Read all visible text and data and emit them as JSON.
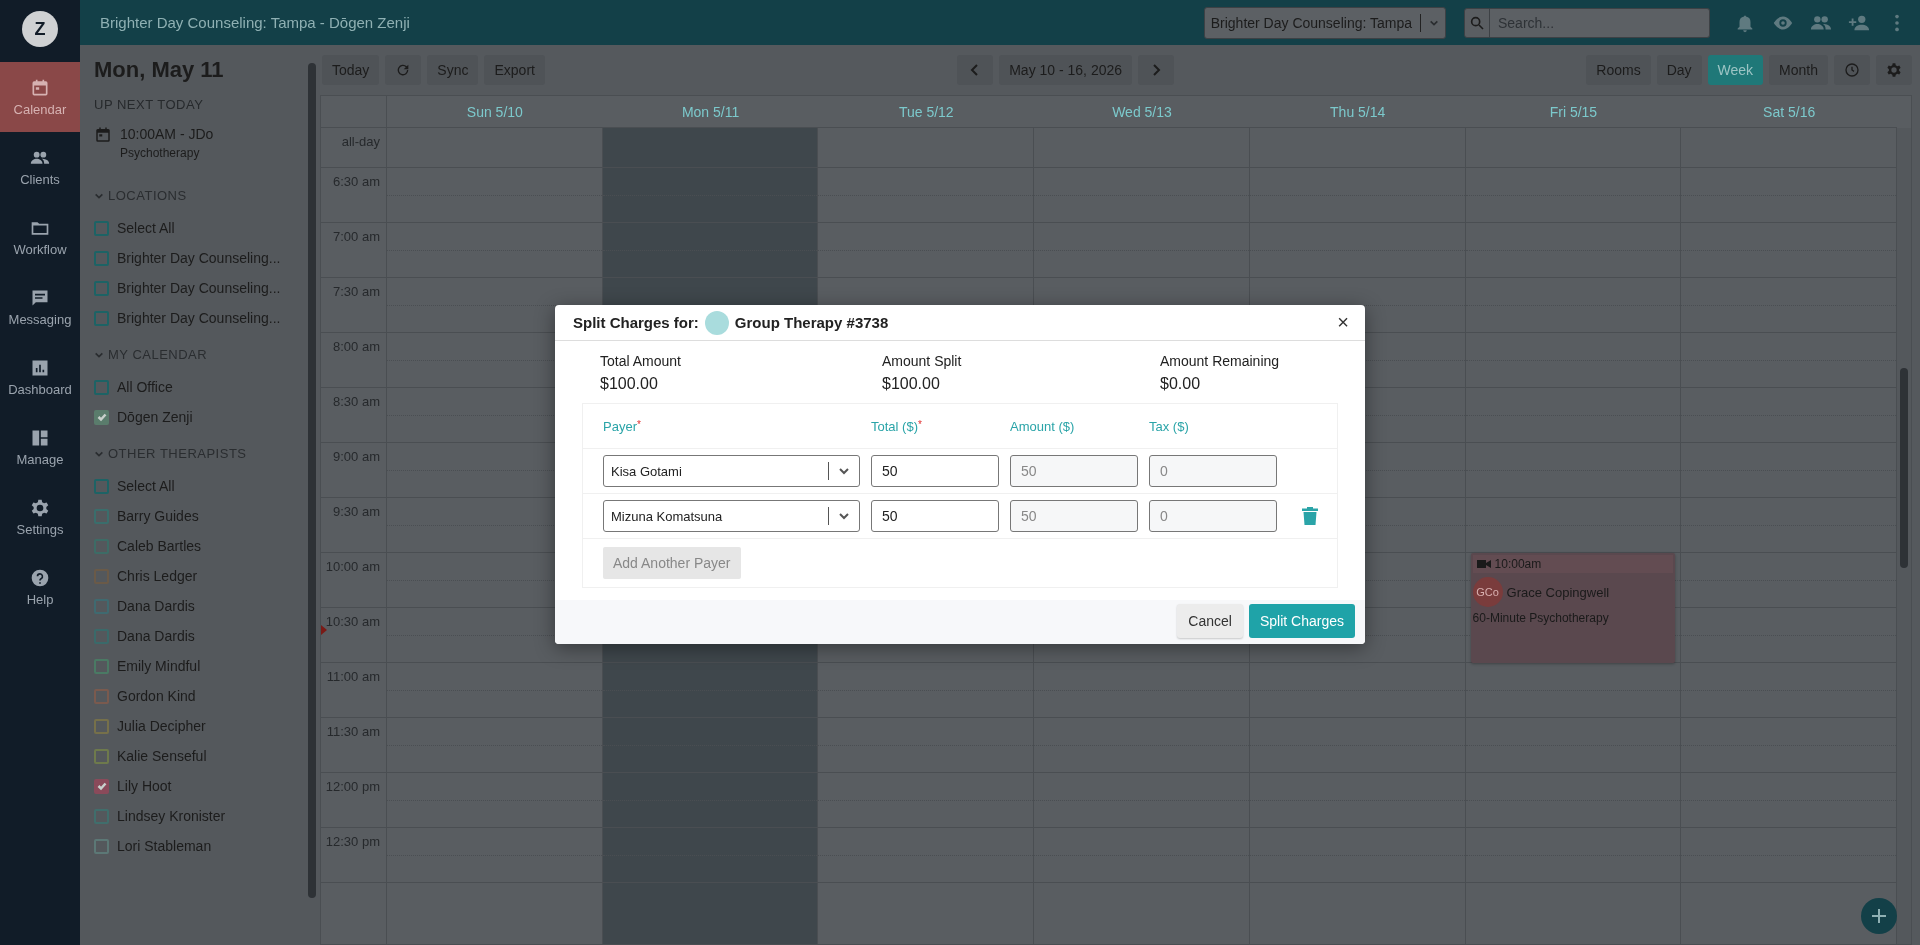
{
  "app": {
    "logo_letter": "Z"
  },
  "top_bar": {
    "title": "Brighter Day Counseling: Tampa - Dōgen Zenji",
    "location_select": "Brighter Day Counseling: Tampa",
    "search": {
      "placeholder": "Search..."
    }
  },
  "nav": [
    {
      "kind": "calendar",
      "label": "Calendar",
      "selected": true
    },
    {
      "kind": "clients",
      "label": "Clients",
      "selected": false
    },
    {
      "kind": "workflow",
      "label": "Workflow",
      "selected": false
    },
    {
      "kind": "messaging",
      "label": "Messaging",
      "selected": false
    },
    {
      "kind": "dashboard",
      "label": "Dashboard",
      "selected": false
    },
    {
      "kind": "manage",
      "label": "Manage",
      "selected": false
    },
    {
      "kind": "settings",
      "label": "Settings",
      "selected": false
    },
    {
      "kind": "help",
      "label": "Help",
      "selected": false
    }
  ],
  "sidebar": {
    "date": "Mon, May 11",
    "up_next_heading": "UP NEXT TODAY",
    "up_next": {
      "time": "10:00AM - JDo",
      "service": "Psychotherapy"
    },
    "sections": [
      {
        "title": "LOCATIONS",
        "expanded": true,
        "items": [
          {
            "label": "Select All",
            "checked": false,
            "color": "#1d6365"
          },
          {
            "label": "Brighter Day Counseling...",
            "checked": false,
            "color": "#1d6365"
          },
          {
            "label": "Brighter Day Counseling...",
            "checked": false,
            "color": "#1d6365"
          },
          {
            "label": "Brighter Day Counseling...",
            "checked": false,
            "color": "#1d6365"
          }
        ]
      },
      {
        "title": "MY CALENDAR",
        "expanded": true,
        "items": [
          {
            "label": "All Office",
            "checked": false,
            "color": "#1d6365"
          },
          {
            "label": "Dōgen Zenji",
            "checked": true,
            "color": "#5a7c6c"
          }
        ]
      },
      {
        "title": "OTHER THERAPISTS",
        "expanded": true,
        "items": [
          {
            "label": "Select All",
            "checked": false,
            "color": "#1d6365"
          },
          {
            "label": "Barry Guides",
            "checked": false,
            "color": "#3a6e6c"
          },
          {
            "label": "Caleb Bartles",
            "checked": false,
            "color": "#3d6c66"
          },
          {
            "label": "Chris Ledger",
            "checked": false,
            "color": "#6a5a48"
          },
          {
            "label": "Dana Dardis",
            "checked": false,
            "color": "#3f6a70"
          },
          {
            "label": "Dana Dardis",
            "checked": false,
            "color": "#3a6a6a"
          },
          {
            "label": "Emily Mindful",
            "checked": false,
            "color": "#4a7a64"
          },
          {
            "label": "Gordon Kind",
            "checked": false,
            "color": "#7a5a4e"
          },
          {
            "label": "Julia Decipher",
            "checked": false,
            "color": "#76704a"
          },
          {
            "label": "Kalie Senseful",
            "checked": false,
            "color": "#6e7a4c"
          },
          {
            "label": "Lily Hoot",
            "checked": true,
            "color": "#8a4a5a"
          },
          {
            "label": "Lindsey Kronister",
            "checked": false,
            "color": "#406e6c"
          },
          {
            "label": "Lori Stableman",
            "checked": false,
            "color": "#5c7876"
          }
        ]
      }
    ]
  },
  "toolbar": {
    "left": [
      {
        "kind": "text",
        "label": "Today"
      },
      {
        "kind": "refresh"
      },
      {
        "kind": "text",
        "label": "Sync"
      },
      {
        "kind": "text",
        "label": "Export"
      }
    ],
    "range": "May 10 - 16, 2026",
    "views": [
      {
        "label": "Rooms",
        "selected": false
      },
      {
        "label": "Day",
        "selected": false
      },
      {
        "label": "Week",
        "selected": true
      },
      {
        "label": "Month",
        "selected": false
      }
    ]
  },
  "calendar": {
    "all_day_label": "all-day",
    "times": [
      "6:30 am",
      "7:00 am",
      "7:30 am",
      "8:00 am",
      "8:30 am",
      "9:00 am",
      "9:30 am",
      "10:00 am",
      "10:30 am",
      "11:00 am",
      "11:30 am",
      "12:00 pm",
      "12:30 pm"
    ],
    "days": [
      {
        "label": "Sun 5/10",
        "today": false
      },
      {
        "label": "Mon 5/11",
        "today": true
      },
      {
        "label": "Tue 5/12",
        "today": false
      },
      {
        "label": "Wed 5/13",
        "today": false
      },
      {
        "label": "Thu 5/14",
        "today": false
      },
      {
        "label": "Fri 5/15",
        "today": false,
        "events": [
          {
            "time": "10:00am",
            "video": true,
            "initials": "GCo",
            "client": "Grace Copingwell",
            "service": "60-Minute Psychotherapy"
          }
        ]
      },
      {
        "label": "Sat 5/16",
        "today": false
      }
    ]
  },
  "modal": {
    "title": "Split Charges for:",
    "subject": "Group Therapy #3738",
    "close_label": "×",
    "summary": [
      {
        "label": "Total Amount",
        "value": "$100.00"
      },
      {
        "label": "Amount Split",
        "value": "$100.00"
      },
      {
        "label": "Amount Remaining",
        "value": "$0.00"
      }
    ],
    "columns": [
      {
        "label": "Payer",
        "required_mark": "*"
      },
      {
        "label": "Total ($)",
        "required_mark": "*"
      },
      {
        "label": "Amount ($)"
      },
      {
        "label": "Tax ($)"
      }
    ],
    "payers": [
      {
        "payer": "Kisa Gotami",
        "total": "50",
        "amount": "50",
        "tax": "0",
        "removable": false
      },
      {
        "payer": "Mizuna Komatsuna",
        "total": "50",
        "amount": "50",
        "tax": "0",
        "removable": true
      }
    ],
    "add_button": {
      "label": "Add Another Payer",
      "disabled": true
    },
    "buttons": [
      {
        "kind": "secondary",
        "label": "Cancel"
      },
      {
        "kind": "primary",
        "label": "Split Charges"
      }
    ]
  }
}
